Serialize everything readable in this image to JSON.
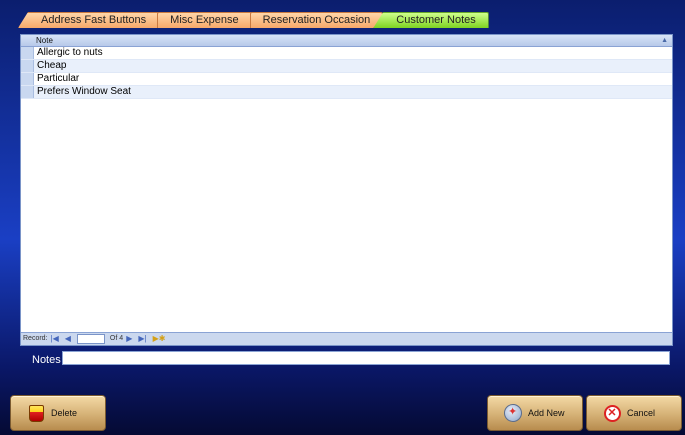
{
  "tabs": [
    {
      "label": "Address Fast Buttons",
      "active": false
    },
    {
      "label": "Misc Expense",
      "active": false
    },
    {
      "label": "Reservation Occasion",
      "active": false
    },
    {
      "label": "Customer Notes",
      "active": true
    }
  ],
  "datasheet": {
    "column_header": "Note",
    "rows": [
      "Allergic to nuts",
      "Cheap",
      "Particular",
      "Prefers Window Seat"
    ]
  },
  "navigator": {
    "record_label": "Record:",
    "current_record": "",
    "of_label": "Of",
    "total": "4"
  },
  "notes": {
    "label": "Notes",
    "value": ""
  },
  "buttons": {
    "delete": "Delete",
    "add_new": "Add New",
    "cancel": "Cancel"
  },
  "colors": {
    "background": "#1a3fc4",
    "tab_inactive": "#f7a86a",
    "tab_active": "#7ed321",
    "button": "#d8b57a"
  },
  "icons": {
    "delete": "bucket-icon",
    "add_new": "add-new-icon",
    "cancel": "cancel-icon"
  }
}
